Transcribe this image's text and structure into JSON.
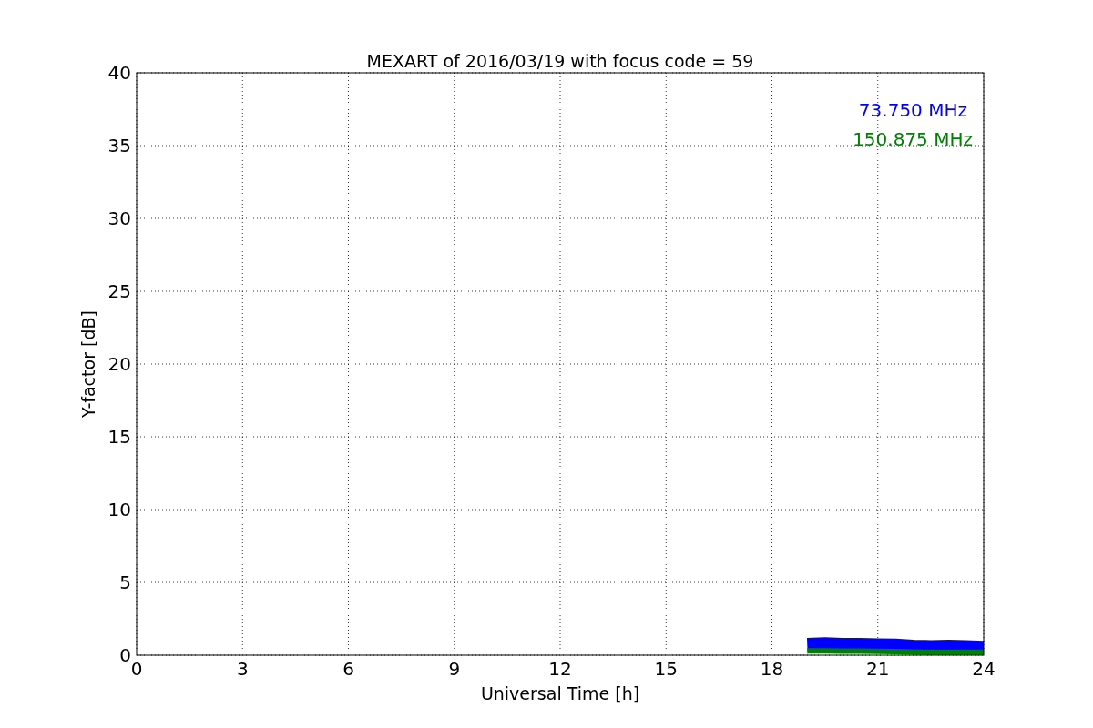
{
  "chart_data": {
    "type": "line",
    "title": "MEXART of 2016/03/19 with focus code = 59",
    "xlabel": "Universal Time [h]",
    "ylabel": "Y-factor [dB]",
    "x": [
      19,
      19.5,
      20,
      20.5,
      21,
      21.5,
      22,
      22.5,
      23,
      23.5,
      24
    ],
    "series": [
      {
        "name": "73.750 MHz",
        "color": "#0000ff",
        "values": [
          0.75,
          0.8,
          0.75,
          0.75,
          0.72,
          0.7,
          0.62,
          0.6,
          0.62,
          0.6,
          0.55
        ]
      },
      {
        "name": "150.875 MHz",
        "color": "#008000",
        "values": [
          0.3,
          0.3,
          0.28,
          0.28,
          0.27,
          0.25,
          0.22,
          0.2,
          0.2,
          0.2,
          0.2
        ]
      }
    ],
    "grid": true,
    "xlim": [
      0,
      24
    ],
    "ylim": [
      0,
      40
    ],
    "xticks": [
      0,
      3,
      6,
      9,
      12,
      15,
      18,
      21,
      24
    ],
    "yticks": [
      0,
      5,
      10,
      15,
      20,
      25,
      30,
      35,
      40
    ]
  }
}
